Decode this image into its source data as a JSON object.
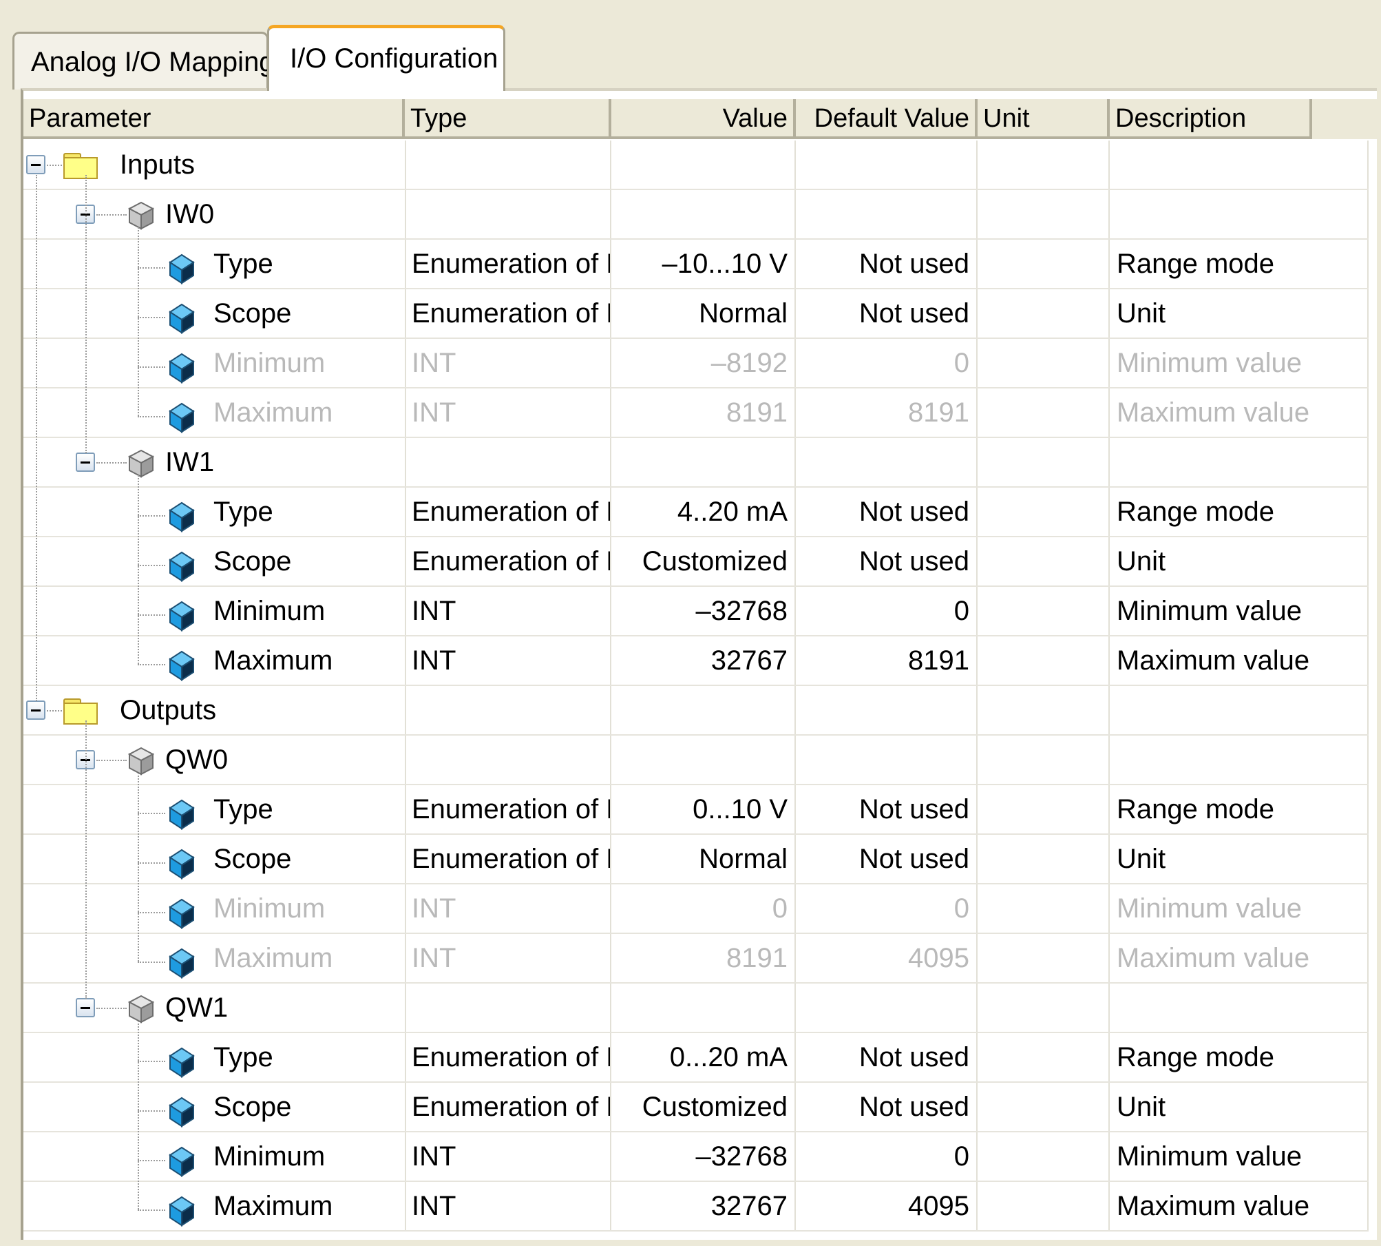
{
  "tabs": [
    {
      "label": "Analog I/O Mapping",
      "active": false
    },
    {
      "label": "I/O Configuration",
      "active": true
    }
  ],
  "columns": [
    "Parameter",
    "Type",
    "Value",
    "Default Value",
    "Unit",
    "Description"
  ],
  "rows": [
    {
      "level": 0,
      "icon": "folder-icon",
      "name": "Inputs",
      "type": "",
      "value": "",
      "default": "",
      "unit": "",
      "description": "",
      "disabled": false
    },
    {
      "level": 1,
      "icon": "channel-icon",
      "name": "IW0",
      "type": "",
      "value": "",
      "default": "",
      "unit": "",
      "description": "",
      "disabled": false
    },
    {
      "level": 2,
      "icon": "parameter-icon",
      "name": "Type",
      "type": "Enumeration of BYTE",
      "value": "–10...10 V",
      "default": "Not used",
      "unit": "",
      "description": "Range mode",
      "disabled": false
    },
    {
      "level": 2,
      "icon": "parameter-icon",
      "name": "Scope",
      "type": "Enumeration of BYTE",
      "value": "Normal",
      "default": "Not used",
      "unit": "",
      "description": "Unit",
      "disabled": false
    },
    {
      "level": 2,
      "icon": "parameter-icon",
      "name": "Minimum",
      "type": "INT",
      "value": "–8192",
      "default": "0",
      "unit": "",
      "description": "Minimum value",
      "disabled": true
    },
    {
      "level": 2,
      "icon": "parameter-icon",
      "name": "Maximum",
      "type": "INT",
      "value": "8191",
      "default": "8191",
      "unit": "",
      "description": "Maximum value",
      "disabled": true
    },
    {
      "level": 1,
      "icon": "channel-icon",
      "name": "IW1",
      "type": "",
      "value": "",
      "default": "",
      "unit": "",
      "description": "",
      "disabled": false
    },
    {
      "level": 2,
      "icon": "parameter-icon",
      "name": "Type",
      "type": "Enumeration of BYTE",
      "value": "4..20 mA",
      "default": "Not used",
      "unit": "",
      "description": "Range mode",
      "disabled": false
    },
    {
      "level": 2,
      "icon": "parameter-icon",
      "name": "Scope",
      "type": "Enumeration of BYTE",
      "value": "Customized",
      "default": "Not used",
      "unit": "",
      "description": "Unit",
      "disabled": false
    },
    {
      "level": 2,
      "icon": "parameter-icon",
      "name": "Minimum",
      "type": "INT",
      "value": "–32768",
      "default": "0",
      "unit": "",
      "description": "Minimum value",
      "disabled": false
    },
    {
      "level": 2,
      "icon": "parameter-icon",
      "name": "Maximum",
      "type": "INT",
      "value": "32767",
      "default": "8191",
      "unit": "",
      "description": "Maximum value",
      "disabled": false
    },
    {
      "level": 0,
      "icon": "folder-icon",
      "name": "Outputs",
      "type": "",
      "value": "",
      "default": "",
      "unit": "",
      "description": "",
      "disabled": false
    },
    {
      "level": 1,
      "icon": "channel-icon",
      "name": "QW0",
      "type": "",
      "value": "",
      "default": "",
      "unit": "",
      "description": "",
      "disabled": false
    },
    {
      "level": 2,
      "icon": "parameter-icon",
      "name": "Type",
      "type": "Enumeration of BYTE",
      "value": "0...10 V",
      "default": "Not used",
      "unit": "",
      "description": "Range mode",
      "disabled": false
    },
    {
      "level": 2,
      "icon": "parameter-icon",
      "name": "Scope",
      "type": "Enumeration of BYTE",
      "value": "Normal",
      "default": "Not used",
      "unit": "",
      "description": "Unit",
      "disabled": false
    },
    {
      "level": 2,
      "icon": "parameter-icon",
      "name": "Minimum",
      "type": "INT",
      "value": "0",
      "default": "0",
      "unit": "",
      "description": "Minimum value",
      "disabled": true
    },
    {
      "level": 2,
      "icon": "parameter-icon",
      "name": "Maximum",
      "type": "INT",
      "value": "8191",
      "default": "4095",
      "unit": "",
      "description": "Maximum value",
      "disabled": true
    },
    {
      "level": 1,
      "icon": "channel-icon",
      "name": "QW1",
      "type": "",
      "value": "",
      "default": "",
      "unit": "",
      "description": "",
      "disabled": false
    },
    {
      "level": 2,
      "icon": "parameter-icon",
      "name": "Type",
      "type": "Enumeration of BYTE",
      "value": "0...20 mA",
      "default": "Not used",
      "unit": "",
      "description": "Range mode",
      "disabled": false
    },
    {
      "level": 2,
      "icon": "parameter-icon",
      "name": "Scope",
      "type": "Enumeration of BYTE",
      "value": "Customized",
      "default": "Not used",
      "unit": "",
      "description": "Unit",
      "disabled": false
    },
    {
      "level": 2,
      "icon": "parameter-icon",
      "name": "Minimum",
      "type": "INT",
      "value": "–32768",
      "default": "0",
      "unit": "",
      "description": "Minimum value",
      "disabled": false
    },
    {
      "level": 2,
      "icon": "parameter-icon",
      "name": "Maximum",
      "type": "INT",
      "value": "32767",
      "default": "4095",
      "unit": "",
      "description": "Maximum value",
      "disabled": false
    }
  ],
  "colors": {
    "active_tab_accent": "#f5a623",
    "folder": "#ffff88",
    "param_cube": "#1e9be0",
    "disabled_text": "#b9b9b9"
  }
}
